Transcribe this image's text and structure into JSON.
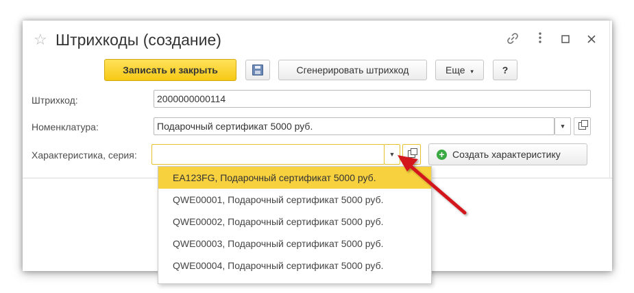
{
  "window": {
    "title": "Штрихкоды (создание)",
    "icons": [
      "star-icon",
      "link-icon",
      "more-icon",
      "maximize-icon",
      "close-icon"
    ]
  },
  "toolbar": {
    "save_close_label": "Записать и закрыть",
    "save_icon": "floppy-disk-icon",
    "generate_label": "Сгенерировать штрихкод",
    "more_label": "Еще",
    "help_label": "?"
  },
  "form": {
    "barcode_label": "Штрихкод:",
    "barcode_value": "2000000000114",
    "nomenclature_label": "Номенклатура:",
    "nomenclature_value": "Подарочный сертификат 5000 руб.",
    "characteristic_label": "Характеристика, серия:",
    "characteristic_value": "",
    "create_characteristic_label": "Создать характеристику"
  },
  "dropdown": {
    "items": [
      "EA123FG, Подарочный сертификат 5000 руб.",
      "QWE00001, Подарочный сертификат 5000 руб.",
      "QWE00002, Подарочный сертификат 5000 руб.",
      "QWE00003, Подарочный сертификат 5000 руб.",
      "QWE00004, Подарочный сертификат 5000 руб."
    ],
    "selected_index": 0
  },
  "colors": {
    "primary_button": "#f6c915",
    "selected_item": "#f8d13f",
    "annotation_arrow": "#d3131b",
    "create_icon": "#3aa843"
  }
}
